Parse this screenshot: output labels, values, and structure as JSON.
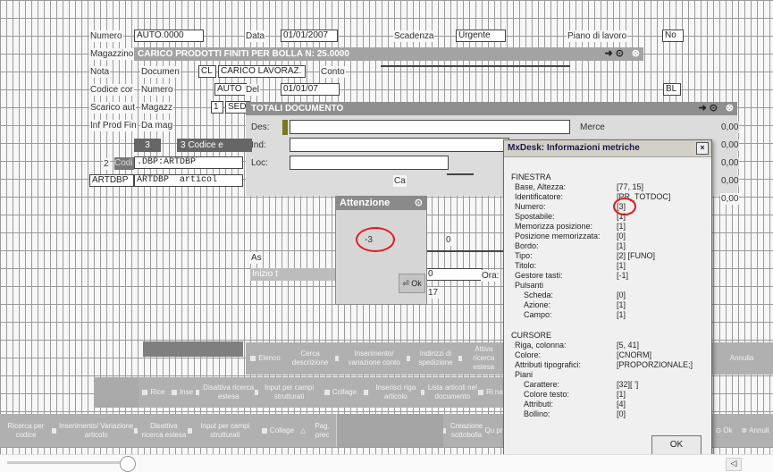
{
  "header_fields": {
    "numero_label": "Numero",
    "numero_value": "AUTO.0000",
    "data_label": "Data",
    "data_value": "01/01/2007",
    "scadenza_label": "Scadenza",
    "urgente_value": "Urgente",
    "piano_label": "Piano di lavoro",
    "piano_value": "No"
  },
  "carico_window": {
    "title": "CARICO PRODOTTI FINITI PER BOLLA N:  25.0000",
    "row_labels": [
      "Magazzino",
      "Nota",
      "Codice cor",
      "Scarico aut",
      "Inf Prod Fin"
    ],
    "documen_label": "Documen",
    "documen_value": "CL",
    "causale_value": "CARICO LAVORAZ.",
    "conto_label": "Conto",
    "bl_value": "BL",
    "numero_label": "Numero",
    "auto_value": "AUTO",
    "del_label": "Del",
    "del_value": "01/01/07",
    "magazz_label": "Magazz",
    "magazz_value": "1",
    "sede_value": "SED",
    "da_mag_label": "Da mag"
  },
  "totali_window": {
    "title": "TOTALI DOCUMENTO",
    "des_label": "Des:",
    "ind_label": "Ind:",
    "loc_label": "Loc:",
    "merce_label": "Merce",
    "amounts": [
      "0,00",
      "0,00",
      "0,00",
      "0,00",
      "0,00"
    ],
    "ca_label": "Ca",
    "as_label": "As",
    "inizio_label": "Inizio t",
    "zero_a": "0",
    "zero_b": "0",
    "seventeen": "17",
    "ora_label": "Ora:"
  },
  "left_rows": {
    "tab3": "3",
    "codice_e": "3 Codice e",
    "tab2": "2",
    "codi": "Codi",
    "dbp_value": ".DBP:ARTDBP",
    "artdbp1": "ARTDBP",
    "artdbp2": "ARTDBP",
    "articol": "articol"
  },
  "attenzione": {
    "title": "Attenzione",
    "value": "-3",
    "ok_label": "Ok"
  },
  "metrics_dialog": {
    "title": "MxDesk: Informazioni metriche",
    "close": "×",
    "ok_label": "OK",
    "sections": [
      {
        "heading": "FINESTRA",
        "rows": [
          [
            "Base, Altezza:",
            "[77, 15]"
          ],
          [
            "Identificatore:",
            "[PR_TOTDOC]"
          ],
          [
            "Numero:",
            "[3]"
          ],
          [
            "Spostabile:",
            "[1]"
          ],
          [
            "Memorizza posizione:",
            "[1]"
          ],
          [
            "Posizione memorizzata:",
            "[0]"
          ],
          [
            "Bordo:",
            "[1]"
          ],
          [
            "Tipo:",
            "[2] [FUNO]"
          ],
          [
            "Titolo:",
            "[1]"
          ],
          [
            "Gestore tasti:",
            "[-1]"
          ],
          [
            "Pulsanti",
            ""
          ],
          [
            "  Scheda:",
            "[0]"
          ],
          [
            "  Azione:",
            "[1]"
          ],
          [
            "  Campo:",
            "[1]"
          ]
        ]
      },
      {
        "heading": "CURSORE",
        "rows": [
          [
            "Riga, colonna:",
            "[5, 41]"
          ],
          [
            "Colore:",
            "[CNORM]"
          ],
          [
            "Attributi tipografici:",
            "[PROPORZIONALE;]"
          ],
          [
            "Piani",
            ""
          ],
          [
            "  Carattere:",
            "[32][ ']"
          ],
          [
            "  Colore testo:",
            "[1]"
          ],
          [
            "  Attributi:",
            "[4]"
          ],
          [
            "  Bollino:",
            "[0]"
          ]
        ]
      }
    ]
  },
  "toolbar_mid": [
    "Elenco",
    "Cerca descrizione",
    "Inserimento/ variazione conto",
    "Indirizzi di spedizione",
    "Attiva ricerca estesa",
    "Annulla"
  ],
  "toolbar_low": [
    "Rice",
    "Inse",
    "Disattiva ricerca estesa",
    "Input per campi strutturati",
    "Collage",
    "Inserisci riga articolo",
    "Lista articoli nel documento",
    "Ri na"
  ],
  "toolbar_bottom": [
    "Ricerca per codice",
    "Inserimento/ Variazione articolo",
    "Disattiva ricerca estesa",
    "Input per campi strutturati",
    "Collage",
    "Pag. prec",
    "Creazione sottobolla",
    "Qu pr"
  ],
  "bottom_right": {
    "ok": "Ok",
    "annulla": "Annull"
  }
}
